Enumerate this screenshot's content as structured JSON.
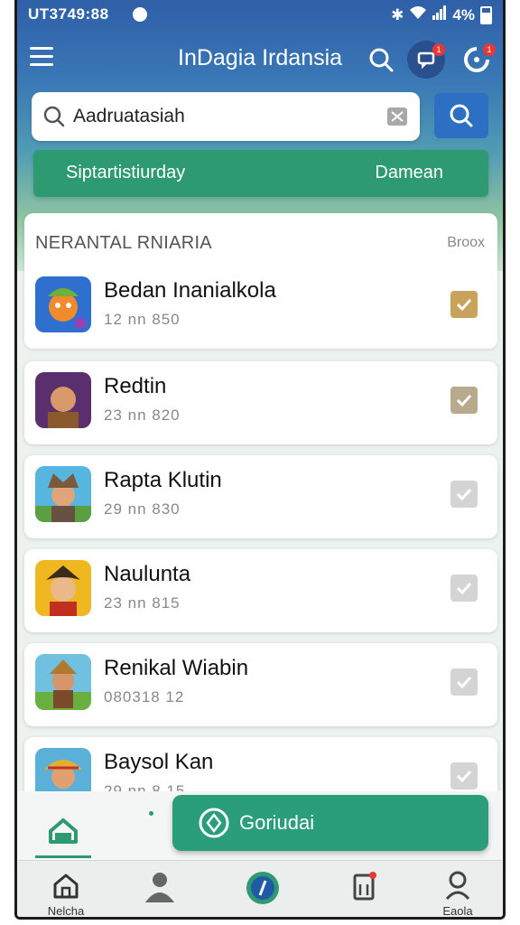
{
  "status_bar": {
    "time": "UT3749:88",
    "battery": "4%"
  },
  "app_bar": {
    "title": "InDagia Irdansia",
    "message_badge": "1",
    "refresh_badge": "1"
  },
  "search": {
    "value": "Aadruatasiah"
  },
  "filter_bar": {
    "left_label": "Siptartistiurday",
    "right_label": "Damean"
  },
  "section": {
    "heading": "NERANTAL RNIARIA",
    "action": "Broox"
  },
  "items": [
    {
      "name": "Bedan Inanialkola",
      "sub": "12 nn 850",
      "checked": true,
      "check_color": "#c9a25b"
    },
    {
      "name": "Redtin",
      "sub": "23 nn 820",
      "checked": true,
      "check_color": "#b8ab8d"
    },
    {
      "name": "Rapta Klutin",
      "sub": "29 nn 830",
      "checked": false,
      "check_color": "#d4d4d4"
    },
    {
      "name": "Naulunta",
      "sub": "23 nn 815",
      "checked": false,
      "check_color": "#d4d4d4"
    },
    {
      "name": "Renikal Wiabin",
      "sub": "080318 12",
      "checked": false,
      "check_color": "#d4d4d4"
    },
    {
      "name": "Baysol Kan",
      "sub": "29 nn 8 15",
      "checked": false,
      "check_color": "#d4d4d4"
    }
  ],
  "fab": {
    "label": "Goriudai"
  },
  "bottom_nav": {
    "first_label": "Nelcha",
    "last_label": "Eaola"
  },
  "colors": {
    "primary_blue": "#2f5fa8",
    "accent_green": "#2e9a72",
    "badge_red": "#e53935"
  }
}
